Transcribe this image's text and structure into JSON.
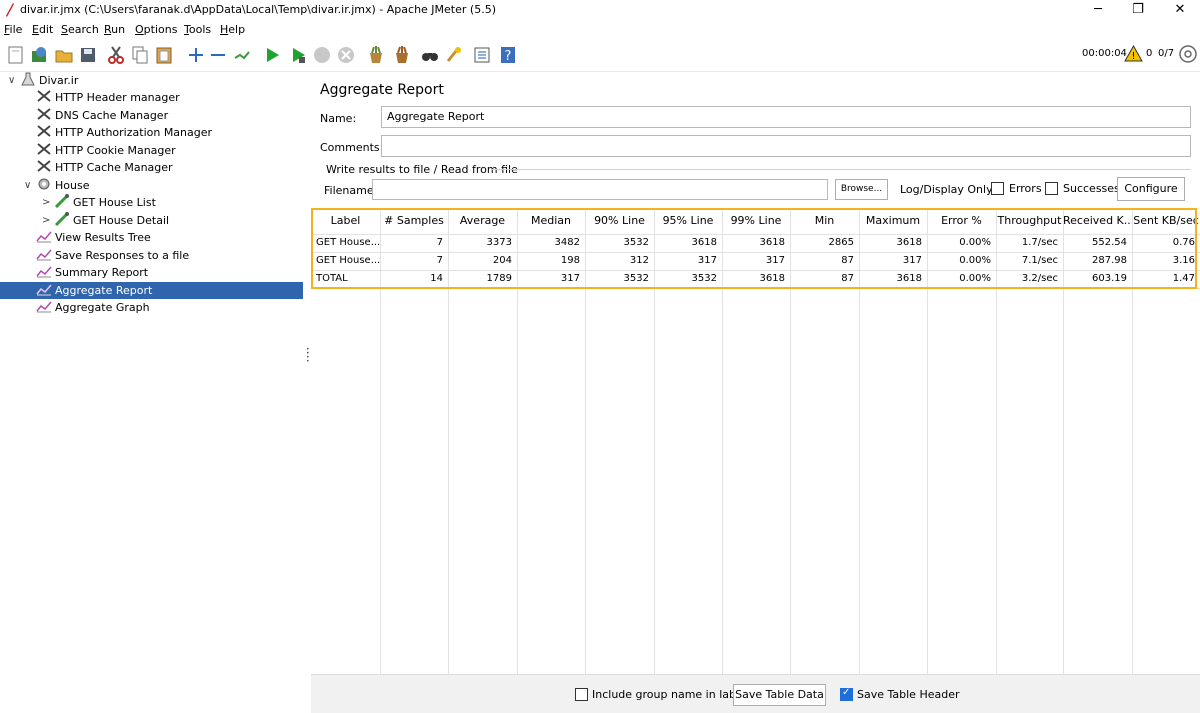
{
  "window": {
    "title": "divar.ir.jmx (C:\\Users\\faranak.d\\AppData\\Local\\Temp\\divar.ir.jmx) - Apache JMeter (5.5)",
    "minimize": "─",
    "restore": "❐",
    "close": "✕"
  },
  "menu": [
    {
      "mnemonic": "F",
      "rest": "ile"
    },
    {
      "mnemonic": "E",
      "rest": "dit"
    },
    {
      "mnemonic": "S",
      "rest": "earch"
    },
    {
      "mnemonic": "R",
      "rest": "un"
    },
    {
      "mnemonic": "O",
      "rest": "ptions"
    },
    {
      "mnemonic": "T",
      "rest": "ools"
    },
    {
      "mnemonic": "H",
      "rest": "elp"
    }
  ],
  "status": {
    "timer": "00:00:04",
    "warnings": "0",
    "threads": "0/7"
  },
  "tree": {
    "root": "Divar.ir",
    "items": [
      {
        "label": "HTTP Header manager",
        "icon": "config-tool-icon"
      },
      {
        "label": "DNS Cache Manager",
        "icon": "config-tool-icon"
      },
      {
        "label": "HTTP Authorization Manager",
        "icon": "config-tool-icon"
      },
      {
        "label": "HTTP Cookie Manager",
        "icon": "config-tool-icon"
      },
      {
        "label": "HTTP Cache Manager",
        "icon": "config-tool-icon"
      },
      {
        "label": "House",
        "icon": "thread-group-gear-icon"
      },
      {
        "label": "GET House List",
        "icon": "sampler-pipette-icon"
      },
      {
        "label": "GET House Detail",
        "icon": "sampler-pipette-icon"
      },
      {
        "label": "View Results Tree",
        "icon": "listener-chart-icon"
      },
      {
        "label": "Save Responses to a file",
        "icon": "listener-chart-icon"
      },
      {
        "label": "Summary Report",
        "icon": "listener-chart-icon"
      },
      {
        "label": "Aggregate Report",
        "icon": "listener-chart-icon"
      },
      {
        "label": "Aggregate Graph",
        "icon": "listener-chart-icon"
      }
    ]
  },
  "panel": {
    "title": "Aggregate Report",
    "name_label": "Name:",
    "name_value": "Aggregate Report",
    "comments_label": "Comments:",
    "comments_value": "",
    "file_group_label": "Write results to file / Read from file",
    "filename_label": "Filename",
    "filename_value": "",
    "browse": "Browse...",
    "log_display": "Log/Display Only:",
    "errors": "Errors",
    "successes": "Successes",
    "configure": "Configure"
  },
  "table": {
    "headers": [
      "Label",
      "# Samples",
      "Average",
      "Median",
      "90% Line",
      "95% Line",
      "99% Line",
      "Min",
      "Maximum",
      "Error %",
      "Throughput",
      "Received K...",
      "Sent KB/sec"
    ],
    "rows": [
      [
        "GET House...",
        "7",
        "3373",
        "3482",
        "3532",
        "3618",
        "3618",
        "2865",
        "3618",
        "0.00%",
        "1.7/sec",
        "552.54",
        "0.76"
      ],
      [
        "GET House...",
        "7",
        "204",
        "198",
        "312",
        "317",
        "317",
        "87",
        "317",
        "0.00%",
        "7.1/sec",
        "287.98",
        "3.16"
      ],
      [
        "TOTAL",
        "14",
        "1789",
        "317",
        "3532",
        "3532",
        "3618",
        "87",
        "3618",
        "0.00%",
        "3.2/sec",
        "603.19",
        "1.47"
      ]
    ]
  },
  "footer": {
    "include_group": "Include group name in label?",
    "include_group_checked": false,
    "save_table_data": "Save Table Data",
    "save_table_header": "Save Table Header",
    "save_table_header_checked": true
  },
  "colors": {
    "selection": "#2f65ad",
    "highlight_border": "#f4b21f",
    "checkbox_checked": "#1e6fd9"
  }
}
